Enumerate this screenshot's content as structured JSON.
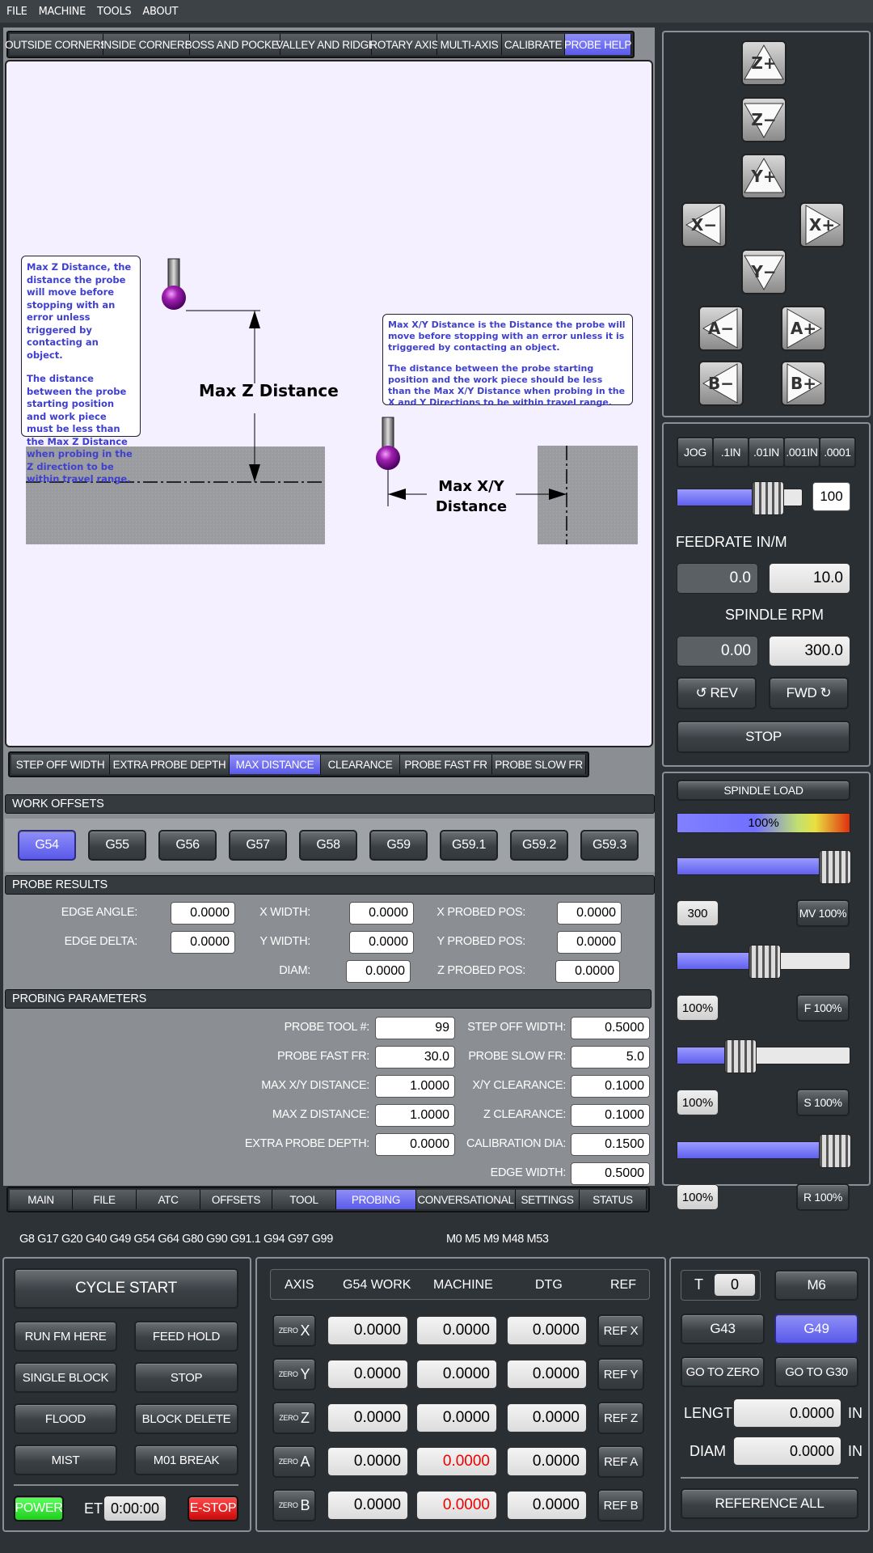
{
  "menu": [
    "FILE",
    "MACHINE",
    "TOOLS",
    "ABOUT"
  ],
  "probe_tabs": [
    {
      "label": "OUTSIDE CORNERS",
      "w": 116
    },
    {
      "label": "INSIDE CORNERS",
      "w": 107
    },
    {
      "label": "BOSS AND POCKET",
      "w": 112
    },
    {
      "label": "VALLEY AND RIDGE",
      "w": 113
    },
    {
      "label": "ROTARY AXIS",
      "w": 81
    },
    {
      "label": "MULTI-AXIS",
      "w": 80
    },
    {
      "label": "CALIBRATE",
      "w": 78
    },
    {
      "label": "PROBE HELP",
      "w": 82,
      "selected": true
    }
  ],
  "help": {
    "z_note_1": "Max Z Distance, the distance the probe will move before stopping with an error unless triggered by contacting an object.",
    "z_note_2": "The distance between the probe starting position and work piece must be less than the Max Z Distance when probing in the Z direction to be within travel range.",
    "z_label": "Max Z Distance",
    "xy_note_1": "Max X/Y Distance is the Distance the probe will move before stopping with an error unless it is triggered by contacting an object.",
    "xy_note_2": "The distance between the probe starting position and the work piece should be less than the Max X/Y Distance when probing in the X and Y Directions to be within travel range.",
    "xy_label_1": "Max X/Y",
    "xy_label_2": "Distance"
  },
  "help_tabs": [
    {
      "label": "STEP OFF WIDTH",
      "w": 122
    },
    {
      "label": "EXTRA PROBE DEPTH",
      "w": 148
    },
    {
      "label": "MAX DISTANCE",
      "w": 113,
      "selected": true
    },
    {
      "label": "CLEARANCE",
      "w": 98
    },
    {
      "label": "PROBE FAST FR",
      "w": 114
    },
    {
      "label": "PROBE SLOW FR",
      "w": 116
    }
  ],
  "work_offsets": {
    "title": "WORK OFFSETS",
    "items": [
      "G54",
      "G55",
      "G56",
      "G57",
      "G58",
      "G59",
      "G59.1",
      "G59.2",
      "G59.3"
    ],
    "selected": "G54"
  },
  "probe_results": {
    "title": "PROBE RESULTS",
    "edge_angle_label": "EDGE ANGLE:",
    "edge_angle": "0.0000",
    "edge_delta_label": "EDGE DELTA:",
    "edge_delta": "0.0000",
    "x_width_label": "X WIDTH:",
    "x_width": "0.0000",
    "y_width_label": "Y WIDTH:",
    "y_width": "0.0000",
    "diam_label": "DIAM:",
    "diam": "0.0000",
    "x_probed_label": "X PROBED POS:",
    "x_probed": "0.0000",
    "y_probed_label": "Y PROBED POS:",
    "y_probed": "0.0000",
    "z_probed_label": "Z PROBED POS:",
    "z_probed": "0.0000"
  },
  "probing_params": {
    "title": "PROBING PARAMETERS",
    "probe_tool_label": "PROBE TOOL #:",
    "probe_tool": "99",
    "probe_fast_label": "PROBE FAST FR:",
    "probe_fast": "30.0",
    "max_xy_label": "MAX X/Y DISTANCE:",
    "max_xy": "1.0000",
    "max_z_label": "MAX Z DISTANCE:",
    "max_z": "1.0000",
    "extra_depth_label": "EXTRA PROBE DEPTH:",
    "extra_depth": "0.0000",
    "step_off_label": "STEP OFF WIDTH:",
    "step_off": "0.5000",
    "probe_slow_label": "PROBE SLOW FR:",
    "probe_slow": "5.0",
    "xy_clear_label": "X/Y CLEARANCE:",
    "xy_clear": "0.1000",
    "z_clear_label": "Z CLEARANCE:",
    "z_clear": "0.1000",
    "cal_dia_label": "CALIBRATION DIA:",
    "cal_dia": "0.1500",
    "edge_width_label": "EDGE WIDTH:",
    "edge_width": "0.5000"
  },
  "main_tabs": [
    {
      "label": "MAIN",
      "w": 78
    },
    {
      "label": "FILE",
      "w": 79
    },
    {
      "label": "ATC",
      "w": 79
    },
    {
      "label": "OFFSETS",
      "w": 89
    },
    {
      "label": "TOOL",
      "w": 79
    },
    {
      "label": "PROBING",
      "w": 99,
      "selected": true
    },
    {
      "label": "CONVERSATIONAL",
      "w": 123
    },
    {
      "label": "SETTINGS",
      "w": 79
    },
    {
      "label": "STATUS",
      "w": 83
    }
  ],
  "gcodes": "G8 G17 G20 G40 G49 G54 G64 G80 G90 G91.1 G94 G97 G99",
  "mcodes": "M0 M5 M9 M48 M53",
  "jog": {
    "labels": {
      "zp": "Z+",
      "zm": "Z−",
      "yp": "Y+",
      "ym": "Y−",
      "xm": "X−",
      "xp": "X+",
      "am": "A−",
      "ap": "A+",
      "bm": "B−",
      "bp": "B+"
    },
    "increments": [
      "JOG",
      ".1IN",
      ".01IN",
      ".001IN",
      ".0001"
    ],
    "jog_rate": "100",
    "jog_rate_pct": 0.42
  },
  "feed": {
    "title": "FEEDRATE IN/M",
    "actual": "0.0",
    "set": "10.0"
  },
  "spindle": {
    "title": "SPINDLE RPM",
    "actual": "0.00",
    "set": "300.0",
    "rev": "REV",
    "fwd": "FWD",
    "stop": "STOP"
  },
  "overrides": {
    "load_title": "SPINDLE LOAD",
    "load_pct": "100%",
    "mv_value": "300",
    "mv_label": "MV 100%",
    "mv_level": 1.0,
    "f_value": "100%",
    "f_label": "F 100%",
    "f_level": 0.5,
    "s_value": "100%",
    "s_label": "S 100%",
    "s_level": 0.33,
    "r_value": "100%",
    "r_label": "R 100%",
    "r_level": 1.0
  },
  "controls": {
    "cycle_start": "CYCLE START",
    "run_from_here": "RUN FM HERE",
    "feed_hold": "FEED HOLD",
    "single_block": "SINGLE BLOCK",
    "stop": "STOP",
    "flood": "FLOOD",
    "block_delete": "BLOCK DELETE",
    "mist": "MIST",
    "m01_break": "M01 BREAK",
    "power": "POWER",
    "et_label": "ET",
    "et_value": "0:00:00",
    "estop": "E-STOP"
  },
  "dro": {
    "headers": [
      "AXIS",
      "G54 WORK",
      "MACHINE",
      "DTG",
      "REF"
    ],
    "zero_label": "ZERO",
    "rows": [
      {
        "axis": "X",
        "work": "0.0000",
        "machine": "0.0000",
        "dtg": "0.0000",
        "ref": "REF X",
        "red": false
      },
      {
        "axis": "Y",
        "work": "0.0000",
        "machine": "0.0000",
        "dtg": "0.0000",
        "ref": "REF Y",
        "red": false
      },
      {
        "axis": "Z",
        "work": "0.0000",
        "machine": "0.0000",
        "dtg": "0.0000",
        "ref": "REF Z",
        "red": false
      },
      {
        "axis": "A",
        "work": "0.0000",
        "machine": "0.0000",
        "dtg": "0.0000",
        "ref": "REF A",
        "red": true
      },
      {
        "axis": "B",
        "work": "0.0000",
        "machine": "0.0000",
        "dtg": "0.0000",
        "ref": "REF B",
        "red": true
      }
    ]
  },
  "tool": {
    "t_label": "T",
    "t_value": "0",
    "m6": "M6",
    "g43": "G43",
    "g49": "G49",
    "go_zero": "GO TO ZERO",
    "go_g30": "GO TO G30",
    "length_label": "LENGTH",
    "length": "0.0000",
    "diam_label": "DIAM",
    "diam": "0.0000",
    "unit": "IN",
    "ref_all": "REFERENCE ALL"
  },
  "colors": {
    "accent": "#6a6af0",
    "bg": "#2d3236",
    "power": "#2ee82e",
    "estop": "#e01010"
  }
}
